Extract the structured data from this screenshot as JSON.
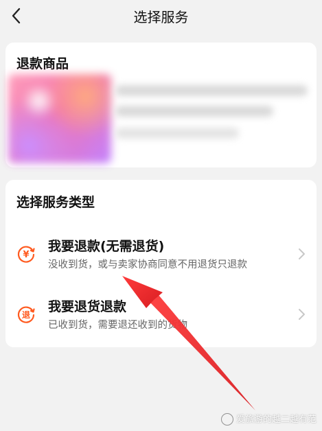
{
  "header": {
    "title": "选择服务",
    "back_icon": "chevron-left-icon"
  },
  "refund_goods": {
    "title": "退款商品"
  },
  "service_type": {
    "title": "选择服务类型",
    "options": [
      {
        "icon": "yuan-refund-icon",
        "icon_text": "¥",
        "title": "我要退款(无需退货)",
        "desc": "没收到货，或与卖家协商同意不用退货只退款"
      },
      {
        "icon": "return-icon",
        "icon_text": "退",
        "title": "我要退货退款",
        "desc": "已收到货，需要退还收到的货物"
      }
    ]
  },
  "watermark": {
    "text": "爱旅游的越二越有范"
  },
  "colors": {
    "accent": "#ff5a1f",
    "arrow": "#e8262a",
    "background": "#f2f2f2",
    "card": "#ffffff"
  }
}
